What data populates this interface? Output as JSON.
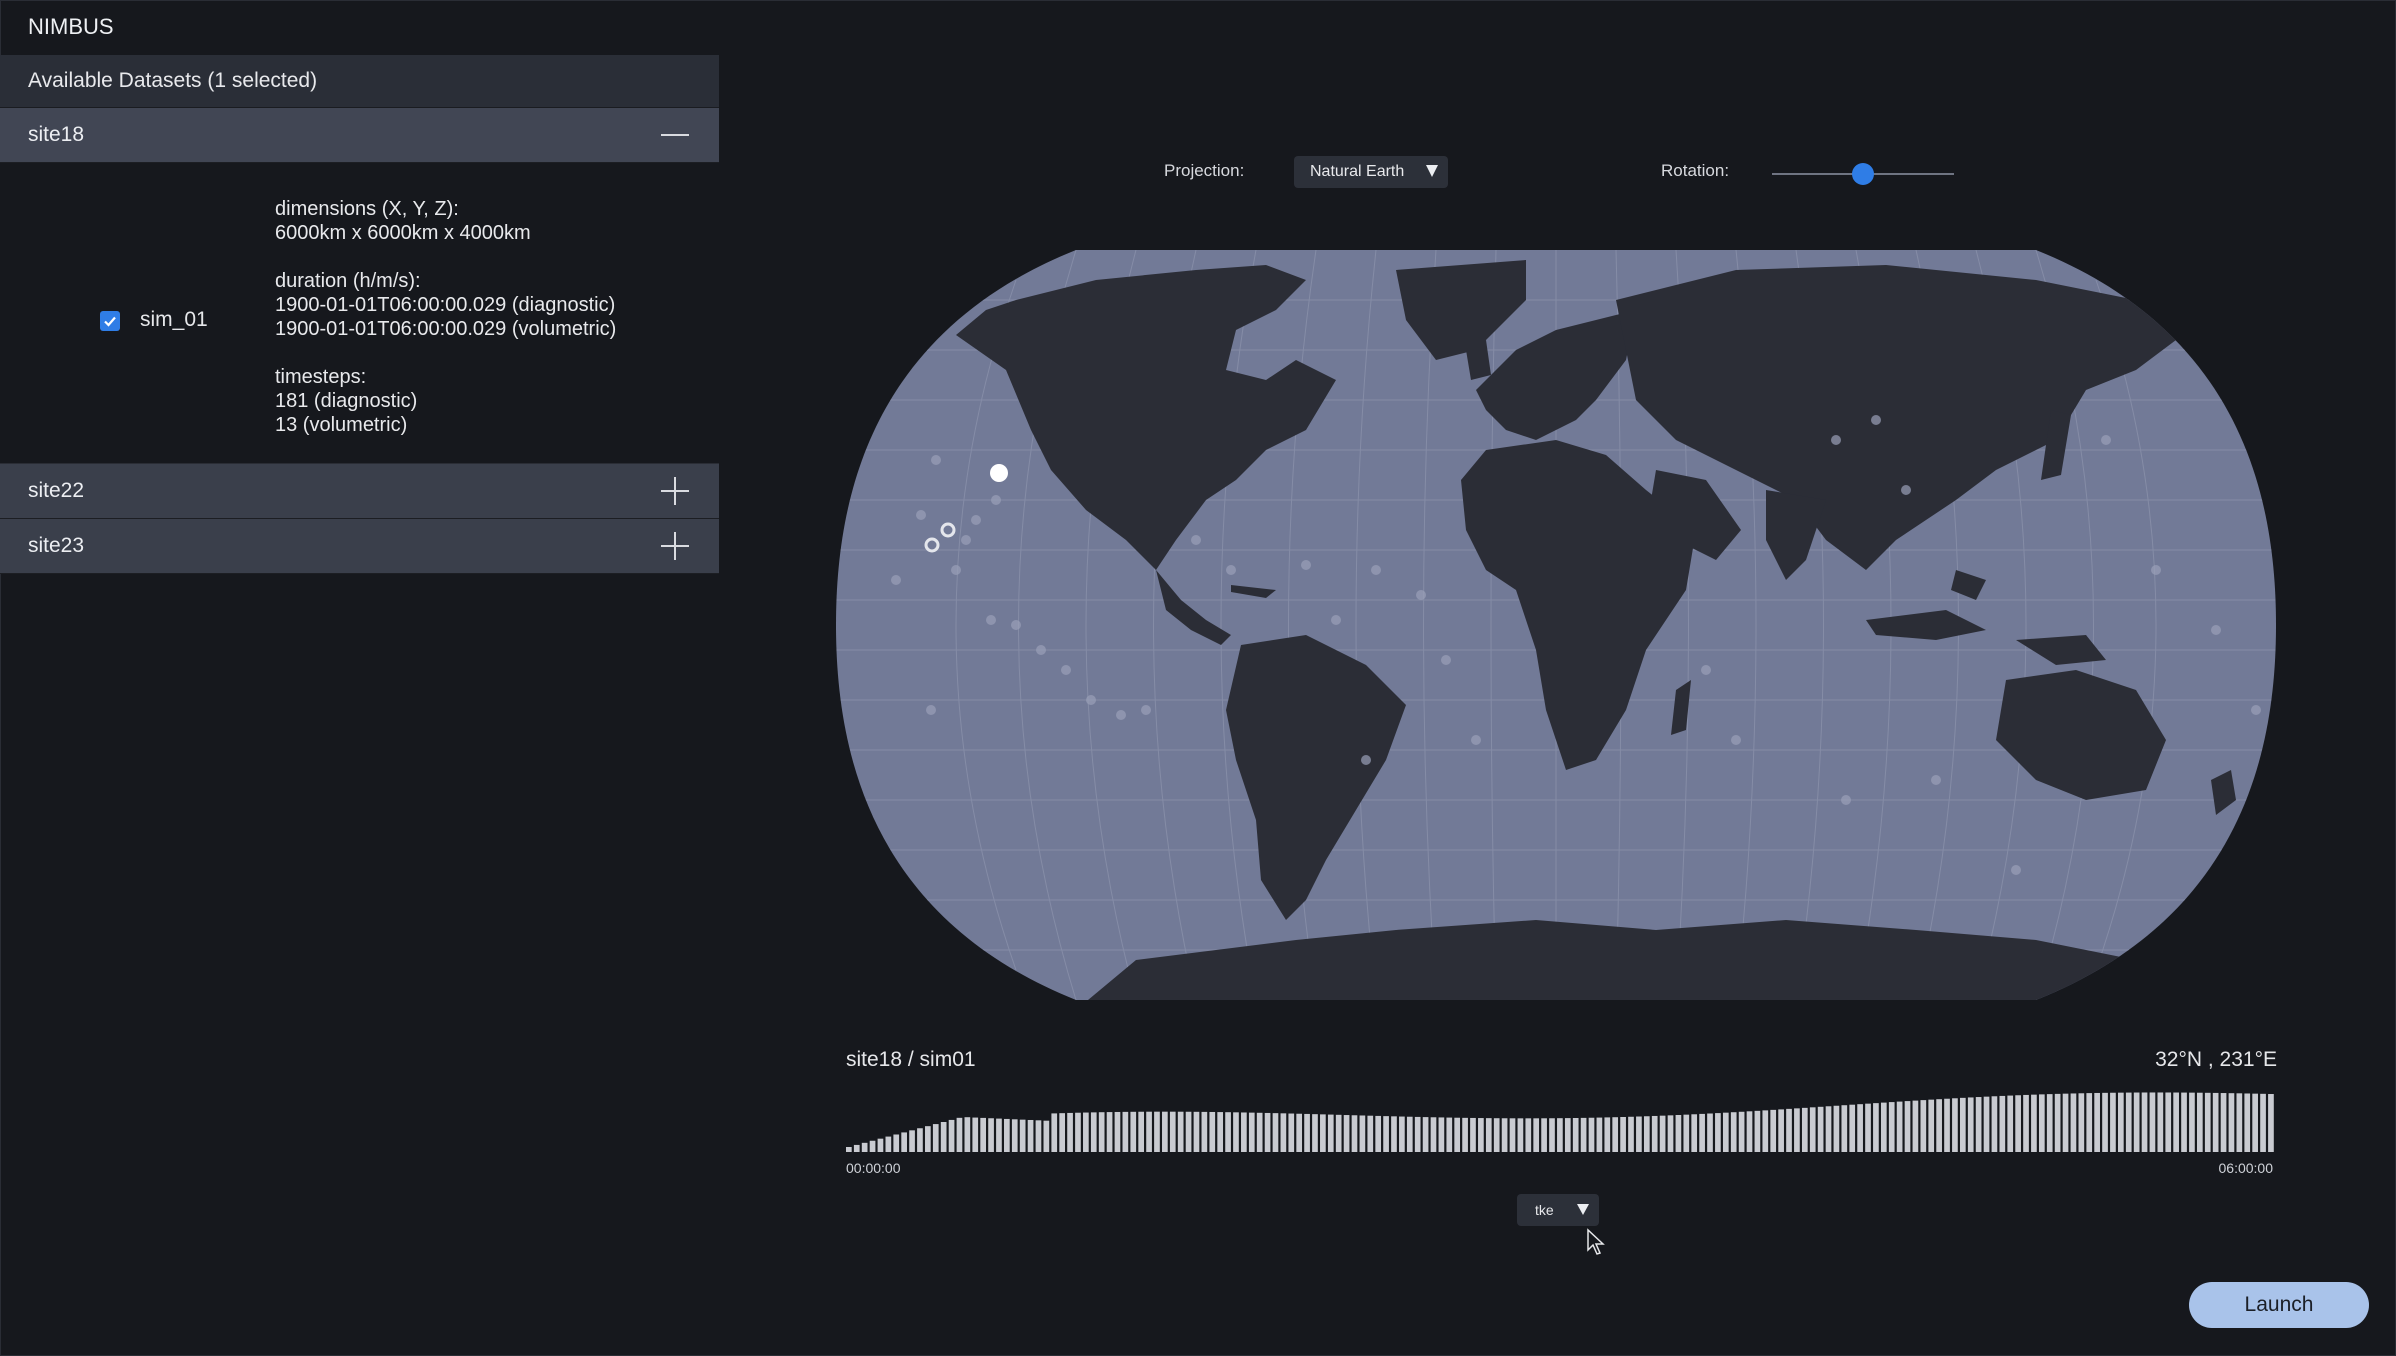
{
  "app": {
    "title": "NIMBUS"
  },
  "sidebar": {
    "header": "Available Datasets (1 selected)",
    "sites": [
      {
        "name": "site18",
        "expanded": true,
        "toggle_icon": "minus-icon"
      },
      {
        "name": "site22",
        "expanded": false,
        "toggle_icon": "plus-icon"
      },
      {
        "name": "site23",
        "expanded": false,
        "toggle_icon": "plus-icon"
      }
    ],
    "simulation": {
      "label": "sim_01",
      "checked": true,
      "dimensions_label": "dimensions (X, Y, Z):",
      "dimensions_value": "6000km x 6000km x 4000km",
      "duration_label": "duration (h/m/s):",
      "duration_diagnostic": "1900-01-01T06:00:00.029 (diagnostic)",
      "duration_volumetric": "1900-01-01T06:00:00.029 (volumetric)",
      "timesteps_label": "timesteps:",
      "timesteps_diagnostic": "181 (diagnostic)",
      "timesteps_volumetric": "13 (volumetric)"
    }
  },
  "map_controls": {
    "projection_label": "Projection:",
    "projection_value": "Natural Earth",
    "rotation_label": "Rotation:",
    "rotation_level": 0.5
  },
  "timeline": {
    "run_title": "site18 / sim01",
    "coordinate": "32°N , 231°E",
    "start_time": "00:00:00",
    "end_time": "06:00:00",
    "variable": "tke"
  },
  "actions": {
    "launch_label": "Launch"
  },
  "colors": {
    "background": "#16181d",
    "ocean": "#727a97",
    "land": "#2b2d36",
    "accent": "#2f7de6",
    "launch": "#a9c3ea"
  }
}
